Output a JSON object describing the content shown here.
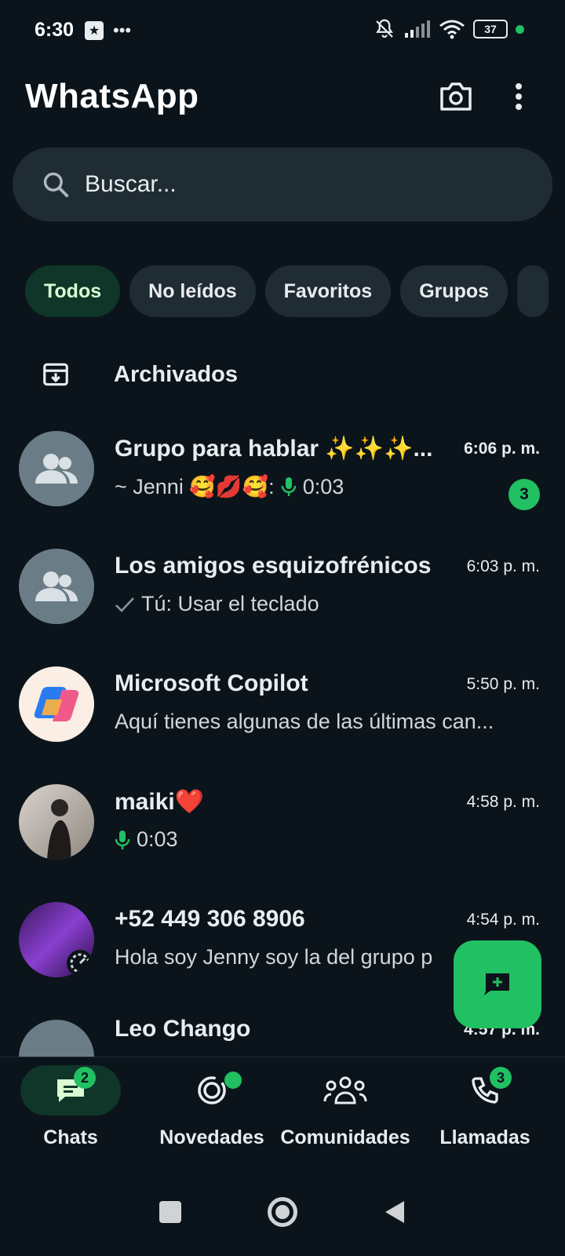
{
  "status_bar": {
    "time": "6:30",
    "battery": "37"
  },
  "header": {
    "title": "WhatsApp"
  },
  "search": {
    "placeholder": "Buscar..."
  },
  "filters": [
    "Todos",
    "No leídos",
    "Favoritos",
    "Grupos"
  ],
  "archived": {
    "label": "Archivados"
  },
  "chats": [
    {
      "name": "Grupo para hablar ✨✨✨...",
      "time": "6:06 p. m.",
      "sender": "~ Jenni 🥰💋🥰:",
      "preview": "0:03",
      "unread": "3"
    },
    {
      "name": "Los amigos esquizofrénicos",
      "time": "6:03 p. m.",
      "preview": "Tú: Usar el teclado"
    },
    {
      "name": "Microsoft Copilot",
      "time": "5:50 p. m.",
      "preview": "Aquí tienes algunas de las últimas can..."
    },
    {
      "name": "maiki❤️",
      "time": "4:58 p. m.",
      "preview": "0:03"
    },
    {
      "name": "+52 449 306 8906",
      "time": "4:54 p. m.",
      "preview": "Hola soy Jenny soy la del grupo p"
    },
    {
      "name": "Leo Chango",
      "time": "4:57 p. m."
    }
  ],
  "bottom_nav": {
    "chats": {
      "label": "Chats",
      "badge": "2"
    },
    "updates": {
      "label": "Novedades"
    },
    "communities": {
      "label": "Comunidades"
    },
    "calls": {
      "label": "Llamadas",
      "badge": "3"
    }
  },
  "colors": {
    "background": "#0b141a",
    "accent": "#21c063",
    "surface": "#202c33"
  },
  "icons": [
    "camera-icon",
    "more-vert-icon",
    "search-icon",
    "archive-icon",
    "group-icon",
    "mic-icon",
    "check-icon",
    "new-chat-icon",
    "chat-icon",
    "updates-icon",
    "communities-icon",
    "phone-icon"
  ]
}
